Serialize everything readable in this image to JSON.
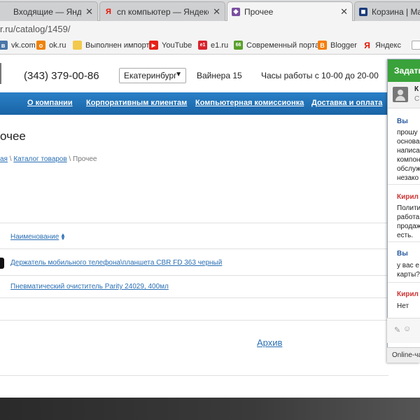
{
  "tabs": [
    {
      "title": "Входящие — Яндекс.Почта",
      "icon": "mail-icon",
      "active": false
    },
    {
      "title": "cn компьютер — Яндекс: нашл",
      "icon": "yandex-icon",
      "active": false
    },
    {
      "title": "Прочее",
      "icon": "site-icon",
      "active": true
    },
    {
      "title": "Корзина | Magaz",
      "icon": "cart-site-icon",
      "active": false
    }
  ],
  "address": {
    "url": "r.ru/catalog/1459/"
  },
  "bookmarks": [
    {
      "label": "vk.com",
      "icon": "vk-icon",
      "color": "#4a76a8"
    },
    {
      "label": "ok.ru",
      "icon": "ok-icon",
      "color": "#ee8208"
    },
    {
      "label": "Выполнен импорт",
      "icon": "folder-icon",
      "color": "#f2c94c"
    },
    {
      "label": "YouTube",
      "icon": "youtube-icon",
      "color": "#e62117"
    },
    {
      "label": "e1.ru",
      "icon": "e1-icon",
      "color": "#d9232d"
    },
    {
      "label": "Современный порта",
      "icon": "66-icon",
      "color": "#5aa02c"
    },
    {
      "label": "Blogger",
      "icon": "blogger-icon",
      "color": "#f57d00"
    },
    {
      "label": "Яндекс",
      "icon": "yandex-icon",
      "color": "#e61400"
    },
    {
      "label": "",
      "icon": "page-icon",
      "color": "#cccccc"
    }
  ],
  "header": {
    "phone": "(343) 379-00-86",
    "city": "Екатеринбург",
    "address": "Вайнера 15",
    "hours": "Часы работы с 10-00 до 20-00"
  },
  "nav": [
    "О компании",
    "Корпоративным клиентам",
    "Компьютерная комиссионка",
    "Доставка и оплата"
  ],
  "page": {
    "title": "очее",
    "breadcrumb_home": "ая",
    "breadcrumb_catalog": "Каталог товаров",
    "breadcrumb_current": "Прочее",
    "column_name": "Наименование",
    "products": [
      "Держатель мобильного телефона\\планшета CBR FD 363 черный",
      "Пневматический очиститель Parity 24029, 400мл"
    ],
    "archive": "Архив"
  },
  "chat": {
    "header": "Задать",
    "operator_initial": "К",
    "operator_status": "С",
    "operator_link": "о",
    "messages": [
      {
        "author": "Вы",
        "type": "me",
        "lines": [
          "прошу",
          "основа",
          "написа",
          "компон",
          "обслуж",
          "незако"
        ]
      },
      {
        "author": "Кирил",
        "type": "op",
        "lines": [
          "Полити",
          "работа",
          "продаж",
          "есть."
        ]
      },
      {
        "author": "Вы",
        "type": "me",
        "lines": [
          "у вас е",
          "карты?"
        ]
      },
      {
        "author": "Кирил",
        "type": "op",
        "lines": [
          "Нет"
        ]
      }
    ],
    "footer": "Online-ча"
  },
  "colors": {
    "nav": "#1f6fb2",
    "chat_header": "#3aa23a",
    "link": "#2a6fb5"
  }
}
